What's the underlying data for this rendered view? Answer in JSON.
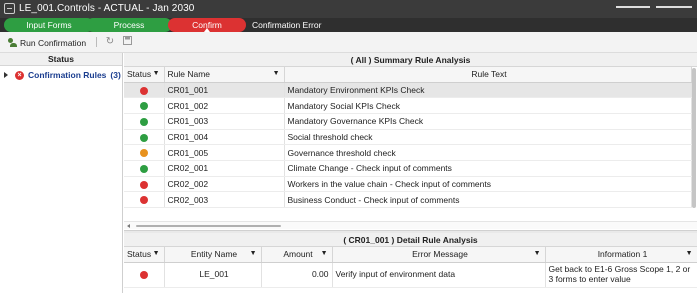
{
  "app": {
    "title": "LE_001.Controls  -  ACTUAL  -  Jan 2030"
  },
  "workflow": {
    "steps": [
      {
        "label": "Input Forms",
        "state": "done"
      },
      {
        "label": "Process",
        "state": "done"
      },
      {
        "label": "Confirm",
        "state": "active"
      }
    ],
    "error_label": "Confirmation Error"
  },
  "toolbar": {
    "run_label": "Run Confirmation",
    "refresh_icon": "refresh-icon",
    "save_icon": "save-icon"
  },
  "left_panel": {
    "header": "Status",
    "tree": {
      "label": "Confirmation Rules",
      "count": "(3)"
    }
  },
  "summary": {
    "title": "( All )  Summary Rule Analysis",
    "columns": {
      "status": "Status",
      "rule_name": "Rule Name",
      "rule_text": "Rule Text"
    },
    "rows": [
      {
        "status": "red",
        "rule_name": "CR01_001",
        "rule_text": "Mandatory Environment KPIs Check"
      },
      {
        "status": "green",
        "rule_name": "CR01_002",
        "rule_text": "Mandatory Social KPIs Check"
      },
      {
        "status": "green",
        "rule_name": "CR01_003",
        "rule_text": "Mandatory Governance KPIs Check"
      },
      {
        "status": "green",
        "rule_name": "CR01_004",
        "rule_text": "Social threshold check"
      },
      {
        "status": "orange",
        "rule_name": "CR01_005",
        "rule_text": "Governance threshold check"
      },
      {
        "status": "green",
        "rule_name": "CR02_001",
        "rule_text": "Climate Change - Check input of comments"
      },
      {
        "status": "red",
        "rule_name": "CR02_002",
        "rule_text": "Workers in the value chain - Check input of comments"
      },
      {
        "status": "red",
        "rule_name": "CR02_003",
        "rule_text": "Business Conduct - Check input of comments"
      }
    ]
  },
  "detail": {
    "title": "( CR01_001 )  Detail Rule Analysis",
    "columns": {
      "status": "Status",
      "entity_name": "Entity Name",
      "amount": "Amount",
      "error_message": "Error Message",
      "information_1": "Information 1"
    },
    "rows": [
      {
        "status": "red",
        "entity_name": "LE_001",
        "amount": "0.00",
        "error_message": "Verify input of environment data",
        "information_1": "Get back to E1-6 Gross Scope 1, 2 or 3 forms to enter value"
      }
    ]
  },
  "colors": {
    "red": "#dc3232",
    "green": "#2e9e42",
    "orange": "#e8921e",
    "link_blue": "#1a3d8f"
  }
}
